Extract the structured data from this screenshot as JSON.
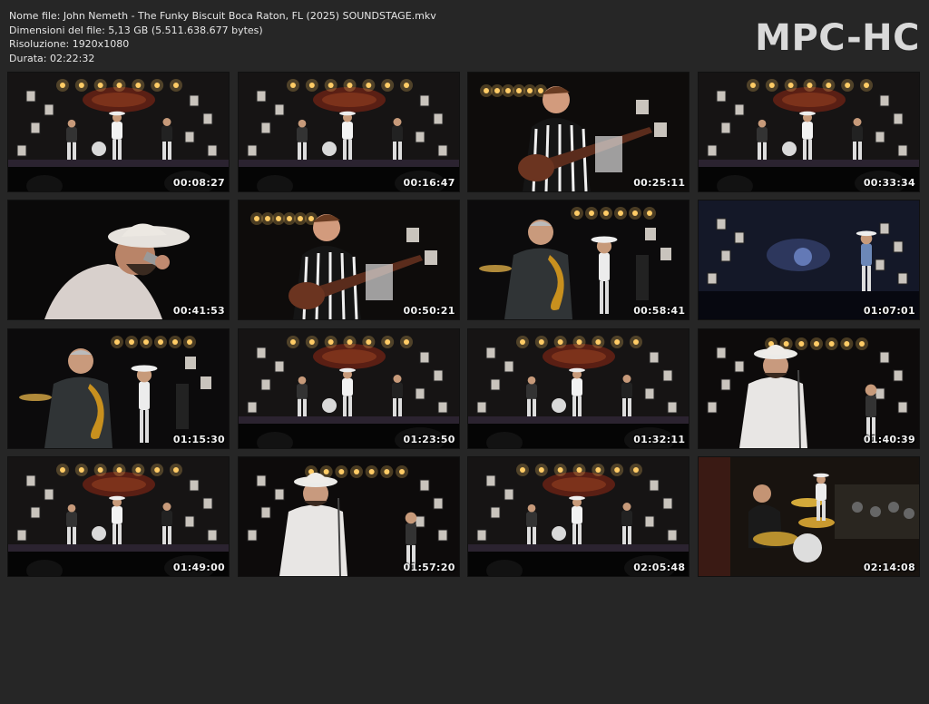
{
  "file_info": {
    "name_line": "Nome file: John Nemeth - The Funky Biscuit Boca Raton, FL (2025) SOUNDSTAGE.mkv",
    "size_line": "Dimensioni del file: 5,13 GB (5.511.638.677 bytes)",
    "resolution_line": "Risoluzione: 1920x1080",
    "duration_line": "Durata: 02:22:32"
  },
  "brand": "MPC-HC",
  "thumbnails": [
    {
      "time": "00:08:27",
      "scene": "wide-stage"
    },
    {
      "time": "00:16:47",
      "scene": "wide-stage"
    },
    {
      "time": "00:25:11",
      "scene": "guitar-closeup"
    },
    {
      "time": "00:33:34",
      "scene": "wide-stage"
    },
    {
      "time": "00:41:53",
      "scene": "harmonica-closeup"
    },
    {
      "time": "00:50:21",
      "scene": "guitar-closeup"
    },
    {
      "time": "00:58:41",
      "scene": "sax-and-singer"
    },
    {
      "time": "01:07:01",
      "scene": "dark-blue-stage"
    },
    {
      "time": "01:15:30",
      "scene": "sax-and-singer"
    },
    {
      "time": "01:23:50",
      "scene": "wide-stage"
    },
    {
      "time": "01:32:11",
      "scene": "wide-stage"
    },
    {
      "time": "01:40:39",
      "scene": "singer-medium"
    },
    {
      "time": "01:49:00",
      "scene": "wide-stage"
    },
    {
      "time": "01:57:20",
      "scene": "singer-medium"
    },
    {
      "time": "02:05:48",
      "scene": "wide-stage"
    },
    {
      "time": "02:14:08",
      "scene": "drummer-side"
    }
  ]
}
